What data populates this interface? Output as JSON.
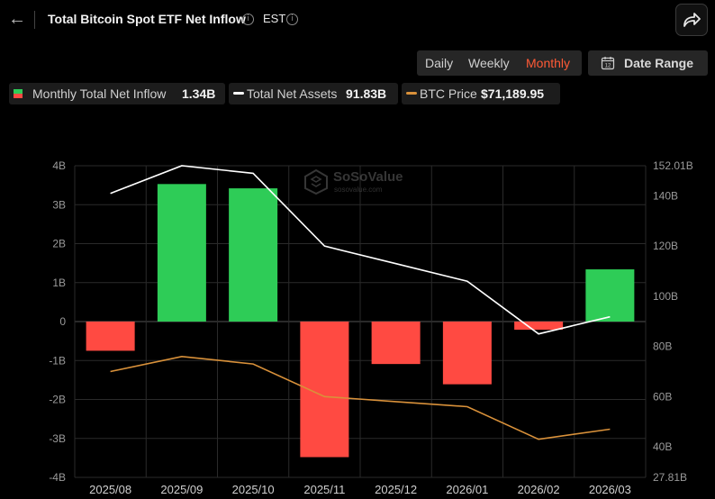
{
  "header": {
    "title": "Total Bitcoin Spot ETF Net Inflow",
    "timezone": "EST"
  },
  "controls": {
    "periods": [
      "Daily",
      "Weekly",
      "Monthly"
    ],
    "active_period": "Monthly",
    "date_range_label": "Date Range"
  },
  "legend": [
    {
      "label": "Monthly Total Net Inflow",
      "value": "1.34B"
    },
    {
      "label": "Total Net Assets",
      "value": "91.83B"
    },
    {
      "label": "BTC Price",
      "value": "$71,189.95"
    }
  ],
  "watermark": {
    "brand": "SoSoValue",
    "sub": "sosovalue.com"
  },
  "colors": {
    "positive": "#2ecc57",
    "negative": "#ff4a42",
    "assets_line": "#ffffff",
    "price_line": "#d9913a",
    "active_tab": "#ff5a36"
  },
  "chart_data": {
    "type": "bar",
    "categories": [
      "2025/08",
      "2025/09",
      "2025/10",
      "2025/11",
      "2025/12",
      "2026/01",
      "2026/02",
      "2026/03"
    ],
    "series": [
      {
        "name": "Monthly Total Net Inflow",
        "type": "bar",
        "axis": "left",
        "values": [
          -0.75,
          3.53,
          3.42,
          -3.48,
          -1.09,
          -1.61,
          -0.21,
          1.34
        ]
      },
      {
        "name": "Total Net Assets",
        "type": "line",
        "axis": "right",
        "values": [
          141,
          152,
          149,
          120,
          113,
          106,
          85,
          91.83
        ]
      },
      {
        "name": "BTC Price",
        "type": "line",
        "axis": "right",
        "values": [
          70,
          76,
          73,
          60,
          58,
          56,
          43,
          47
        ]
      }
    ],
    "y_left": {
      "ylim": [
        -4,
        4
      ],
      "ticks": [
        "-4B",
        "-3B",
        "-2B",
        "-1B",
        "0",
        "1B",
        "2B",
        "3B",
        "4B"
      ],
      "tick_values": [
        -4,
        -3,
        -2,
        -1,
        0,
        1,
        2,
        3,
        4
      ]
    },
    "y_right": {
      "ylim": [
        27.81,
        152.01
      ],
      "ticks": [
        "27.81B",
        "40B",
        "60B",
        "80B",
        "100B",
        "120B",
        "140B",
        "152.01B"
      ],
      "tick_values": [
        27.81,
        40,
        60,
        80,
        100,
        120,
        140,
        152.01
      ]
    },
    "grid": true,
    "legend_position": "top-left"
  }
}
